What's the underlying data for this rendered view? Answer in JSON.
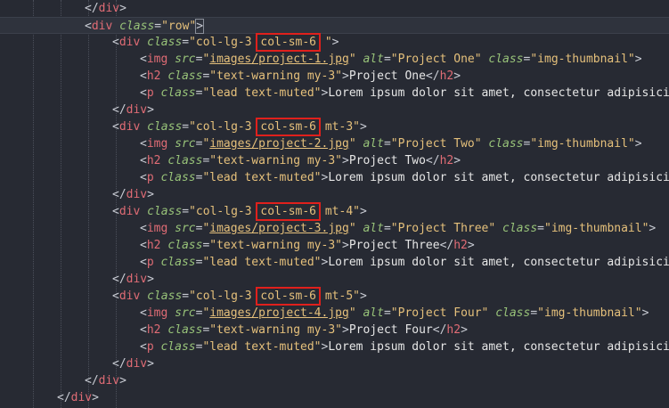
{
  "editor": {
    "lines": [
      {
        "indent": 3,
        "tokens": [
          {
            "t": "punc",
            "v": "</"
          },
          {
            "t": "tag",
            "v": "div"
          },
          {
            "t": "punc",
            "v": ">"
          }
        ]
      },
      {
        "indent": 3,
        "current": true,
        "tokens": [
          {
            "t": "punc",
            "v": "<"
          },
          {
            "t": "tag",
            "v": "div"
          },
          {
            "t": "text",
            "v": " "
          },
          {
            "t": "attr",
            "v": "class"
          },
          {
            "t": "eq",
            "v": "="
          },
          {
            "t": "str",
            "v": "\"row\""
          },
          {
            "t": "punc",
            "v": ">",
            "match": true
          }
        ]
      },
      {
        "indent": 4,
        "tokens": [
          {
            "t": "punc",
            "v": "<"
          },
          {
            "t": "tag",
            "v": "div"
          },
          {
            "t": "text",
            "v": " "
          },
          {
            "t": "attr",
            "v": "class"
          },
          {
            "t": "eq",
            "v": "="
          },
          {
            "t": "str",
            "v": "\"col-lg-3 "
          },
          {
            "t": "str",
            "v": "col-sm-6",
            "hl": true
          },
          {
            "t": "str",
            "v": " \""
          },
          {
            "t": "punc",
            "v": ">"
          }
        ]
      },
      {
        "indent": 5,
        "tokens": [
          {
            "t": "punc",
            "v": "<"
          },
          {
            "t": "tag",
            "v": "img"
          },
          {
            "t": "text",
            "v": " "
          },
          {
            "t": "attr",
            "v": "src"
          },
          {
            "t": "eq",
            "v": "="
          },
          {
            "t": "str",
            "v": "\""
          },
          {
            "t": "url",
            "v": "images/project-1.jpg"
          },
          {
            "t": "str",
            "v": "\""
          },
          {
            "t": "text",
            "v": " "
          },
          {
            "t": "attr",
            "v": "alt"
          },
          {
            "t": "eq",
            "v": "="
          },
          {
            "t": "str",
            "v": "\"Project One\""
          },
          {
            "t": "text",
            "v": " "
          },
          {
            "t": "attr",
            "v": "class"
          },
          {
            "t": "eq",
            "v": "="
          },
          {
            "t": "str",
            "v": "\"img-thumbnail\""
          },
          {
            "t": "punc",
            "v": ">"
          }
        ]
      },
      {
        "indent": 5,
        "tokens": [
          {
            "t": "punc",
            "v": "<"
          },
          {
            "t": "tag",
            "v": "h2"
          },
          {
            "t": "text",
            "v": " "
          },
          {
            "t": "attr",
            "v": "class"
          },
          {
            "t": "eq",
            "v": "="
          },
          {
            "t": "str",
            "v": "\"text-warning my-3\""
          },
          {
            "t": "punc",
            "v": ">"
          },
          {
            "t": "text",
            "v": "Project One"
          },
          {
            "t": "punc",
            "v": "</"
          },
          {
            "t": "tag",
            "v": "h2"
          },
          {
            "t": "punc",
            "v": ">"
          }
        ]
      },
      {
        "indent": 5,
        "tokens": [
          {
            "t": "punc",
            "v": "<"
          },
          {
            "t": "tag",
            "v": "p"
          },
          {
            "t": "text",
            "v": " "
          },
          {
            "t": "attr",
            "v": "class"
          },
          {
            "t": "eq",
            "v": "="
          },
          {
            "t": "str",
            "v": "\"lead text-muted\""
          },
          {
            "t": "punc",
            "v": ">"
          },
          {
            "t": "text",
            "v": "Lorem ipsum dolor sit amet, consectetur adipisicing"
          }
        ]
      },
      {
        "indent": 4,
        "tokens": [
          {
            "t": "punc",
            "v": "</"
          },
          {
            "t": "tag",
            "v": "div"
          },
          {
            "t": "punc",
            "v": ">"
          }
        ]
      },
      {
        "indent": 4,
        "tokens": [
          {
            "t": "punc",
            "v": "<"
          },
          {
            "t": "tag",
            "v": "div"
          },
          {
            "t": "text",
            "v": " "
          },
          {
            "t": "attr",
            "v": "class"
          },
          {
            "t": "eq",
            "v": "="
          },
          {
            "t": "str",
            "v": "\"col-lg-3 "
          },
          {
            "t": "str",
            "v": "col-sm-6",
            "hl": true
          },
          {
            "t": "str",
            "v": " mt-3\""
          },
          {
            "t": "punc",
            "v": ">"
          }
        ]
      },
      {
        "indent": 5,
        "tokens": [
          {
            "t": "punc",
            "v": "<"
          },
          {
            "t": "tag",
            "v": "img"
          },
          {
            "t": "text",
            "v": " "
          },
          {
            "t": "attr",
            "v": "src"
          },
          {
            "t": "eq",
            "v": "="
          },
          {
            "t": "str",
            "v": "\""
          },
          {
            "t": "url",
            "v": "images/project-2.jpg"
          },
          {
            "t": "str",
            "v": "\""
          },
          {
            "t": "text",
            "v": " "
          },
          {
            "t": "attr",
            "v": "alt"
          },
          {
            "t": "eq",
            "v": "="
          },
          {
            "t": "str",
            "v": "\"Project Two\""
          },
          {
            "t": "text",
            "v": " "
          },
          {
            "t": "attr",
            "v": "class"
          },
          {
            "t": "eq",
            "v": "="
          },
          {
            "t": "str",
            "v": "\"img-thumbnail\""
          },
          {
            "t": "punc",
            "v": ">"
          }
        ]
      },
      {
        "indent": 5,
        "tokens": [
          {
            "t": "punc",
            "v": "<"
          },
          {
            "t": "tag",
            "v": "h2"
          },
          {
            "t": "text",
            "v": " "
          },
          {
            "t": "attr",
            "v": "class"
          },
          {
            "t": "eq",
            "v": "="
          },
          {
            "t": "str",
            "v": "\"text-warning my-3\""
          },
          {
            "t": "punc",
            "v": ">"
          },
          {
            "t": "text",
            "v": "Project Two"
          },
          {
            "t": "punc",
            "v": "</"
          },
          {
            "t": "tag",
            "v": "h2"
          },
          {
            "t": "punc",
            "v": ">"
          }
        ]
      },
      {
        "indent": 5,
        "tokens": [
          {
            "t": "punc",
            "v": "<"
          },
          {
            "t": "tag",
            "v": "p"
          },
          {
            "t": "text",
            "v": " "
          },
          {
            "t": "attr",
            "v": "class"
          },
          {
            "t": "eq",
            "v": "="
          },
          {
            "t": "str",
            "v": "\"lead text-muted\""
          },
          {
            "t": "punc",
            "v": ">"
          },
          {
            "t": "text",
            "v": "Lorem ipsum dolor sit amet, consectetur adipisicing"
          }
        ]
      },
      {
        "indent": 4,
        "tokens": [
          {
            "t": "punc",
            "v": "</"
          },
          {
            "t": "tag",
            "v": "div"
          },
          {
            "t": "punc",
            "v": ">"
          }
        ]
      },
      {
        "indent": 4,
        "tokens": [
          {
            "t": "punc",
            "v": "<"
          },
          {
            "t": "tag",
            "v": "div"
          },
          {
            "t": "text",
            "v": " "
          },
          {
            "t": "attr",
            "v": "class"
          },
          {
            "t": "eq",
            "v": "="
          },
          {
            "t": "str",
            "v": "\"col-lg-3 "
          },
          {
            "t": "str",
            "v": "col-sm-6",
            "hl": true
          },
          {
            "t": "str",
            "v": " mt-4\""
          },
          {
            "t": "punc",
            "v": ">"
          }
        ]
      },
      {
        "indent": 5,
        "tokens": [
          {
            "t": "punc",
            "v": "<"
          },
          {
            "t": "tag",
            "v": "img"
          },
          {
            "t": "text",
            "v": " "
          },
          {
            "t": "attr",
            "v": "src"
          },
          {
            "t": "eq",
            "v": "="
          },
          {
            "t": "str",
            "v": "\""
          },
          {
            "t": "url",
            "v": "images/project-3.jpg"
          },
          {
            "t": "str",
            "v": "\""
          },
          {
            "t": "text",
            "v": " "
          },
          {
            "t": "attr",
            "v": "alt"
          },
          {
            "t": "eq",
            "v": "="
          },
          {
            "t": "str",
            "v": "\"Project Three\""
          },
          {
            "t": "text",
            "v": " "
          },
          {
            "t": "attr",
            "v": "class"
          },
          {
            "t": "eq",
            "v": "="
          },
          {
            "t": "str",
            "v": "\"img-thumbnail\""
          },
          {
            "t": "punc",
            "v": ">"
          }
        ]
      },
      {
        "indent": 5,
        "tokens": [
          {
            "t": "punc",
            "v": "<"
          },
          {
            "t": "tag",
            "v": "h2"
          },
          {
            "t": "text",
            "v": " "
          },
          {
            "t": "attr",
            "v": "class"
          },
          {
            "t": "eq",
            "v": "="
          },
          {
            "t": "str",
            "v": "\"text-warning my-3\""
          },
          {
            "t": "punc",
            "v": ">"
          },
          {
            "t": "text",
            "v": "Project Three"
          },
          {
            "t": "punc",
            "v": "</"
          },
          {
            "t": "tag",
            "v": "h2"
          },
          {
            "t": "punc",
            "v": ">"
          }
        ]
      },
      {
        "indent": 5,
        "tokens": [
          {
            "t": "punc",
            "v": "<"
          },
          {
            "t": "tag",
            "v": "p"
          },
          {
            "t": "text",
            "v": " "
          },
          {
            "t": "attr",
            "v": "class"
          },
          {
            "t": "eq",
            "v": "="
          },
          {
            "t": "str",
            "v": "\"lead text-muted\""
          },
          {
            "t": "punc",
            "v": ">"
          },
          {
            "t": "text",
            "v": "Lorem ipsum dolor sit amet, consectetur adipisicing"
          }
        ]
      },
      {
        "indent": 4,
        "tokens": [
          {
            "t": "punc",
            "v": "</"
          },
          {
            "t": "tag",
            "v": "div"
          },
          {
            "t": "punc",
            "v": ">"
          }
        ]
      },
      {
        "indent": 4,
        "tokens": [
          {
            "t": "punc",
            "v": "<"
          },
          {
            "t": "tag",
            "v": "div"
          },
          {
            "t": "text",
            "v": " "
          },
          {
            "t": "attr",
            "v": "class"
          },
          {
            "t": "eq",
            "v": "="
          },
          {
            "t": "str",
            "v": "\"col-lg-3 "
          },
          {
            "t": "str",
            "v": "col-sm-6",
            "hl": true
          },
          {
            "t": "str",
            "v": " mt-5\""
          },
          {
            "t": "punc",
            "v": ">"
          }
        ]
      },
      {
        "indent": 5,
        "tokens": [
          {
            "t": "punc",
            "v": "<"
          },
          {
            "t": "tag",
            "v": "img"
          },
          {
            "t": "text",
            "v": " "
          },
          {
            "t": "attr",
            "v": "src"
          },
          {
            "t": "eq",
            "v": "="
          },
          {
            "t": "str",
            "v": "\""
          },
          {
            "t": "url",
            "v": "images/project-4.jpg"
          },
          {
            "t": "str",
            "v": "\""
          },
          {
            "t": "text",
            "v": " "
          },
          {
            "t": "attr",
            "v": "alt"
          },
          {
            "t": "eq",
            "v": "="
          },
          {
            "t": "str",
            "v": "\"Project Four\""
          },
          {
            "t": "text",
            "v": " "
          },
          {
            "t": "attr",
            "v": "class"
          },
          {
            "t": "eq",
            "v": "="
          },
          {
            "t": "str",
            "v": "\"img-thumbnail\""
          },
          {
            "t": "punc",
            "v": ">"
          }
        ]
      },
      {
        "indent": 5,
        "tokens": [
          {
            "t": "punc",
            "v": "<"
          },
          {
            "t": "tag",
            "v": "h2"
          },
          {
            "t": "text",
            "v": " "
          },
          {
            "t": "attr",
            "v": "class"
          },
          {
            "t": "eq",
            "v": "="
          },
          {
            "t": "str",
            "v": "\"text-warning my-3\""
          },
          {
            "t": "punc",
            "v": ">"
          },
          {
            "t": "text",
            "v": "Project Four"
          },
          {
            "t": "punc",
            "v": "</"
          },
          {
            "t": "tag",
            "v": "h2"
          },
          {
            "t": "punc",
            "v": ">"
          }
        ]
      },
      {
        "indent": 5,
        "tokens": [
          {
            "t": "punc",
            "v": "<"
          },
          {
            "t": "tag",
            "v": "p"
          },
          {
            "t": "text",
            "v": " "
          },
          {
            "t": "attr",
            "v": "class"
          },
          {
            "t": "eq",
            "v": "="
          },
          {
            "t": "str",
            "v": "\"lead text-muted\""
          },
          {
            "t": "punc",
            "v": ">"
          },
          {
            "t": "text",
            "v": "Lorem ipsum dolor sit amet, consectetur adipisicing"
          }
        ]
      },
      {
        "indent": 4,
        "tokens": [
          {
            "t": "punc",
            "v": "</"
          },
          {
            "t": "tag",
            "v": "div"
          },
          {
            "t": "punc",
            "v": ">"
          }
        ]
      },
      {
        "indent": 3,
        "tokens": [
          {
            "t": "punc",
            "v": "</"
          },
          {
            "t": "tag",
            "v": "div"
          },
          {
            "t": "punc",
            "v": ">"
          }
        ]
      },
      {
        "indent": 2,
        "tokens": [
          {
            "t": "punc",
            "v": "</"
          },
          {
            "t": "tag",
            "v": "div"
          },
          {
            "t": "punc",
            "v": ">"
          }
        ]
      }
    ]
  },
  "colors": {
    "background": "#272a33",
    "tag": "#e06c75",
    "attribute": "#98c379",
    "string": "#e5c07b",
    "text": "#e6e6e6",
    "highlight_box": "#e0201c"
  }
}
